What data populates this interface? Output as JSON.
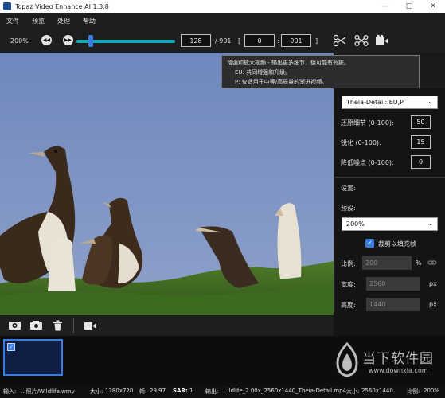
{
  "window": {
    "title": "Topaz Video Enhance AI 1.3.8"
  },
  "menu": [
    "文件",
    "预览",
    "处理",
    "帮助"
  ],
  "toolbar": {
    "zoom": "200%",
    "current_frame": "128",
    "total_frames": "/ 901",
    "range_open": "[",
    "range_start": "0",
    "range_sep": ":",
    "range_end": "901",
    "range_close": "]",
    "slider_progress": 0.142
  },
  "tooltip": {
    "line1": "增强和放大视频 - 输出更多细节，但可能有瑕疵。",
    "line2": "EU:  共同增强和升级。",
    "line3": "P:  仅适用于中等/高质量的渐进视频。"
  },
  "panel": {
    "model_select": "Theia-Detail: EU,P",
    "restore_detail_label": "还原细节 (0-100):",
    "restore_detail_value": "50",
    "sharpen_label": "锐化 (0-100):",
    "sharpen_value": "15",
    "denoise_label": "降低噪点 (0-100):",
    "denoise_value": "0",
    "settings_label": "设置:",
    "preset_label": "预设:",
    "preset_select": "200%",
    "crop_label": "裁剪以填充帧",
    "scale_label": "比例:",
    "scale_value": "200",
    "scale_unit": "%",
    "width_label": "宽度:",
    "width_value": "2560",
    "width_unit": "px",
    "height_label": "高度:",
    "height_value": "1440",
    "height_unit": "px"
  },
  "watermark": {
    "text": "当下软件园",
    "url": "www.downxia.com"
  },
  "status": {
    "input_label": "输入:",
    "input_file": "...照片/Wildlife.wmv",
    "size_label": "大小:",
    "size_value": "1280x720",
    "fps_label": "帧:",
    "fps_value": "29.97",
    "sar_label": "SAR:",
    "sar_value": "1",
    "output_label": "输出:",
    "output_file": "...ildlife_2.00x_2560x1440_Theia-Detail.mp4",
    "out_size_label": "大小:",
    "out_size_value": "2560x1440",
    "ratio_label": "比例:",
    "ratio_value": "200%"
  },
  "colors": {
    "accent": "#3a7de0",
    "slider": "#14a8b8",
    "sky": "#7d95c8"
  }
}
